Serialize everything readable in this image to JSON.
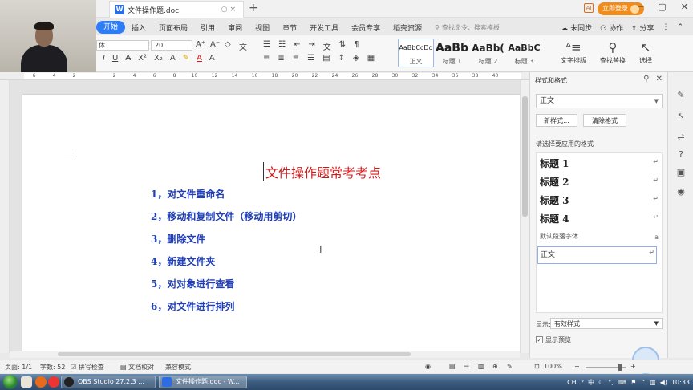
{
  "tabbar": {
    "doc_icon_letter": "W",
    "doc_title": "文件操作题.doc",
    "new_tab": "+",
    "notify": "AI",
    "login": "立即登录",
    "win_min": "─",
    "win_max": "▢",
    "win_close": "✕"
  },
  "menu": {
    "items": [
      "开始",
      "插入",
      "页面布局",
      "引用",
      "审阅",
      "视图",
      "章节",
      "开发工具",
      "会员专享",
      "稻壳资源"
    ],
    "search_placeholder": "查找命令、搜索模板",
    "unsynced": "未同步",
    "collab": "协作",
    "share": "分享"
  },
  "ribbon": {
    "font_name": "体",
    "font_size": "20",
    "styles": [
      {
        "preview": "AaBbCcDd",
        "label": "正文"
      },
      {
        "preview": "AaBb",
        "label": "标题 1"
      },
      {
        "preview": "AaBb(",
        "label": "标题 2"
      },
      {
        "preview": "AaBbC",
        "label": "标题 3"
      }
    ],
    "text_layout": "文字排版",
    "find_replace": "查找替换",
    "select": "选择"
  },
  "ruler": {
    "numbers": [
      "6",
      "4",
      "2",
      "",
      "2",
      "4",
      "6",
      "8",
      "10",
      "12",
      "14",
      "16",
      "18",
      "20",
      "22",
      "24",
      "26",
      "28",
      "30",
      "32",
      "34",
      "36",
      "38",
      "40"
    ]
  },
  "document": {
    "title": "文件操作题常考考点",
    "items": [
      "1，对文件重命名",
      "2，移动和复制文件（移动用剪切）",
      "3，删除文件",
      "4，新建文件夹",
      "5，对对象进行查看",
      "6，对文件进行排列"
    ]
  },
  "style_pane": {
    "title": "样式和格式",
    "current_style": "正文",
    "new_style": "新样式...",
    "clear_format": "清除格式",
    "apply_label": "请选择要应用的格式",
    "entries": [
      {
        "name": "标题  1",
        "mark": "↵"
      },
      {
        "name": "标题  2",
        "mark": "↵"
      },
      {
        "name": "标题  3",
        "mark": "↵"
      },
      {
        "name": "标题  4",
        "mark": "↵"
      },
      {
        "name": "默认段落字体",
        "mark": "a"
      },
      {
        "name": "正文",
        "mark": "↵"
      }
    ],
    "show_label": "显示:",
    "show_value": "有效样式",
    "preview_label": "显示预览"
  },
  "statusbar": {
    "page": "页面: 1/1",
    "words": "字数: 52",
    "spell": "拼写检查",
    "proof": "文档校对",
    "compat": "兼容模式",
    "zoom": "100%"
  },
  "taskbar": {
    "obs": "OBS Studio 27.2.3 ...",
    "wps": "文件操作题.doc - W...",
    "ime": "CH",
    "lang": "中",
    "clock": "10:33"
  },
  "colors": {
    "accent": "#2e7cf6",
    "title_red": "#d11b1b",
    "list_blue": "#1f3eb8",
    "login_orange": "#f08c1c"
  }
}
